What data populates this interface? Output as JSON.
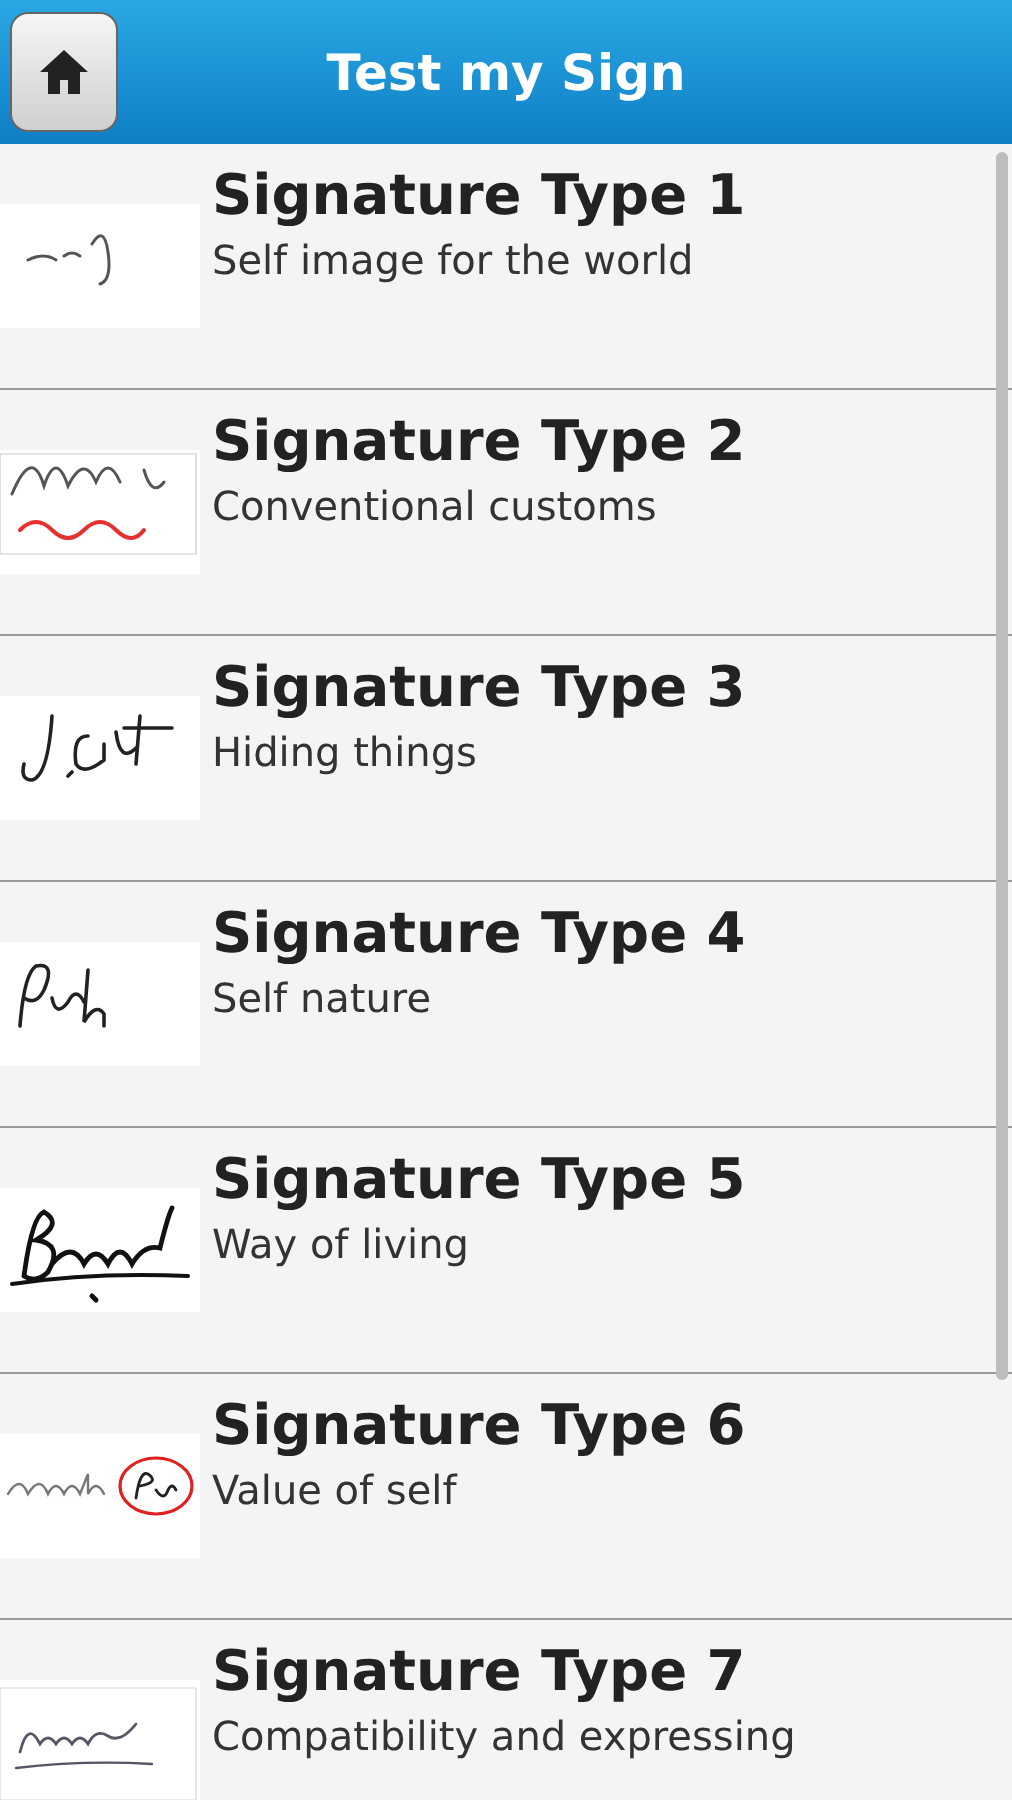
{
  "header": {
    "title": "Test my Sign"
  },
  "items": [
    {
      "title": "Signature Type 1",
      "subtitle": "Self image for the world"
    },
    {
      "title": "Signature Type 2",
      "subtitle": "Conventional customs"
    },
    {
      "title": "Signature Type 3",
      "subtitle": "Hiding things"
    },
    {
      "title": "Signature Type 4",
      "subtitle": "Self nature"
    },
    {
      "title": "Signature Type 5",
      "subtitle": "Way of living"
    },
    {
      "title": "Signature Type 6",
      "subtitle": "Value of self"
    },
    {
      "title": "Signature Type 7",
      "subtitle": "Compatibility and expressing"
    }
  ]
}
